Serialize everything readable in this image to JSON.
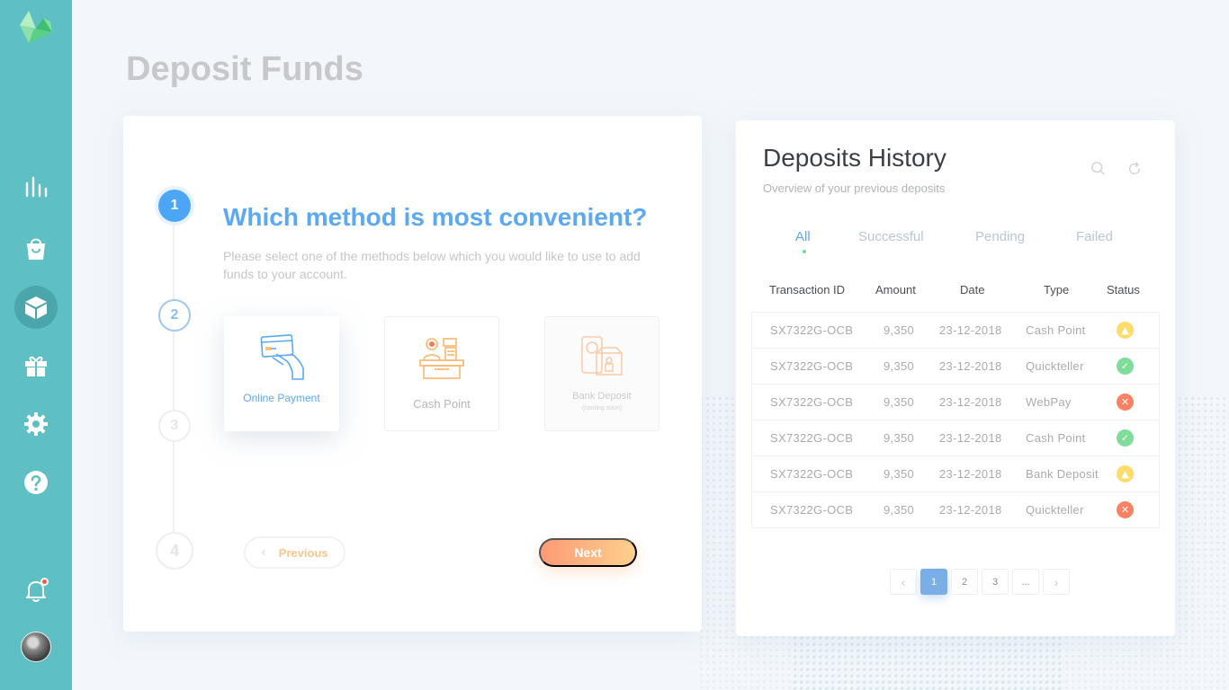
{
  "page": {
    "title": "Deposit Funds"
  },
  "sidebar": {
    "items": [
      {
        "name": "analytics",
        "icon": "bar-chart-icon"
      },
      {
        "name": "shop",
        "icon": "shopping-bag-icon"
      },
      {
        "name": "deposit",
        "icon": "box-icon",
        "active": true
      },
      {
        "name": "rewards",
        "icon": "gift-icon"
      },
      {
        "name": "settings",
        "icon": "gear-icon"
      },
      {
        "name": "help",
        "icon": "question-icon"
      }
    ],
    "notifications_icon": "bell-icon",
    "accent": "#5ec0c4"
  },
  "wizard": {
    "steps": [
      "1",
      "2",
      "3",
      "4"
    ],
    "current_step": 1,
    "question": "Which method is most convenient?",
    "description": "Please select one of the methods below which you would like to use to add funds to your account.",
    "methods": [
      {
        "label": "Online Payment",
        "icon": "card-payment-icon",
        "selected": true
      },
      {
        "label": "Cash Point",
        "icon": "cashier-icon"
      },
      {
        "label": "Bank Deposit",
        "sub": "(coming soon)",
        "icon": "bank-safe-icon",
        "disabled": true
      }
    ],
    "previous_label": "Previous",
    "next_label": "Next"
  },
  "history": {
    "title": "Deposits History",
    "subtitle": "Overview of your previous deposits",
    "tabs": [
      "All",
      "Successful",
      "Pending",
      "Failed"
    ],
    "active_tab": "All",
    "columns": [
      "Transaction ID",
      "Amount",
      "Date",
      "Type",
      "Status"
    ],
    "rows": [
      {
        "id": "SX7322G-OCB",
        "amount": "9,350",
        "date": "23-12-2018",
        "type": "Cash Point",
        "status": "pending"
      },
      {
        "id": "SX7322G-OCB",
        "amount": "9,350",
        "date": "23-12-2018",
        "type": "Quickteller",
        "status": "success"
      },
      {
        "id": "SX7322G-OCB",
        "amount": "9,350",
        "date": "23-12-2018",
        "type": "WebPay",
        "status": "failed"
      },
      {
        "id": "SX7322G-OCB",
        "amount": "9,350",
        "date": "23-12-2018",
        "type": "Cash Point",
        "status": "success"
      },
      {
        "id": "SX7322G-OCB",
        "amount": "9,350",
        "date": "23-12-2018",
        "type": "Bank Deposit",
        "status": "pending"
      },
      {
        "id": "SX7322G-OCB",
        "amount": "9,350",
        "date": "23-12-2018",
        "type": "Quickteller",
        "status": "failed"
      }
    ],
    "pagination": {
      "pages": [
        "1",
        "2",
        "3",
        "..."
      ],
      "current": "1"
    },
    "status_colors": {
      "pending": "#fedc6a",
      "success": "#7ddd99",
      "failed": "#fa8262"
    }
  }
}
